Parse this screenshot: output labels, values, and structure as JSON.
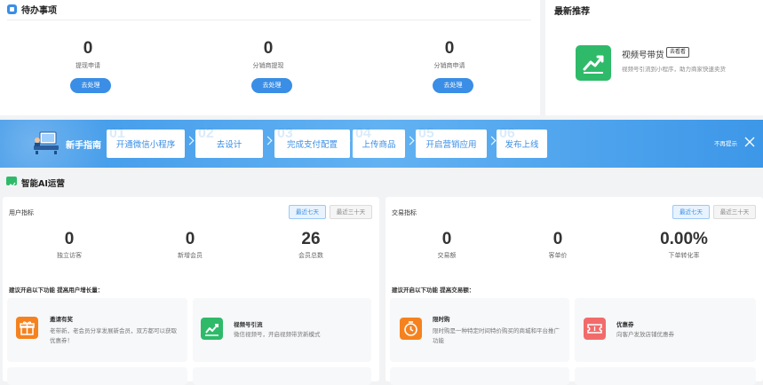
{
  "todo": {
    "title": "待办事项",
    "items": [
      {
        "value": "0",
        "label": "提现申请",
        "button": "去处理"
      },
      {
        "value": "0",
        "label": "分销商提现",
        "button": "去处理"
      },
      {
        "value": "0",
        "label": "分销商申请",
        "button": "去处理"
      }
    ]
  },
  "recommend": {
    "title": "最新推荐",
    "item_title": "视频号带货",
    "item_tag": "去看看",
    "item_desc": "视频号引流到小程序，助力商家快速卖货"
  },
  "guide": {
    "title": "新手指南",
    "steps": [
      {
        "num": "01",
        "label": "开通微信小程序"
      },
      {
        "num": "02",
        "label": "去设计"
      },
      {
        "num": "03",
        "label": "完成支付配置"
      },
      {
        "num": "04",
        "label": "上传商品"
      },
      {
        "num": "05",
        "label": "开启营销应用"
      },
      {
        "num": "06",
        "label": "发布上线"
      }
    ],
    "dismiss": "不再提示"
  },
  "ai_ops": {
    "title": "智能AI运营"
  },
  "user_metrics": {
    "title": "用户指标",
    "tab_active": "最近七天",
    "tab_inactive": "最近三十天",
    "stats": [
      {
        "value": "0",
        "label": "独立访客"
      },
      {
        "value": "0",
        "label": "新增会员"
      },
      {
        "value": "26",
        "label": "会员总数"
      }
    ],
    "suggest_title": "建议开启以下功能 提高用户增长量：",
    "suggestions": [
      {
        "title": "邀请有奖",
        "desc": "老带新，老会员分享发展新会员，双方都可以获取优惠券！"
      },
      {
        "title": "视频号引流",
        "desc": "微信视频号，开启视频带货新模式"
      }
    ]
  },
  "trade_metrics": {
    "title": "交易指标",
    "tab_active": "最近七天",
    "tab_inactive": "最近三十天",
    "stats": [
      {
        "value": "0",
        "label": "交易额"
      },
      {
        "value": "0",
        "label": "客单价"
      },
      {
        "value": "0.00%",
        "label": "下单转化率"
      }
    ],
    "suggest_title": "建议开启以下功能 提高交易额：",
    "suggestions": [
      {
        "title": "限时购",
        "desc": "限时购是一种特定时间特价购买的商城和平台推广功能"
      },
      {
        "title": "优惠券",
        "desc": "向客户发放店铺优惠券"
      }
    ]
  },
  "colors": {
    "accent": "#3a8ee6",
    "banner": "#3d97e8",
    "green": "#2fba6a",
    "orange": "#f5821f",
    "red": "#f26b6b"
  }
}
